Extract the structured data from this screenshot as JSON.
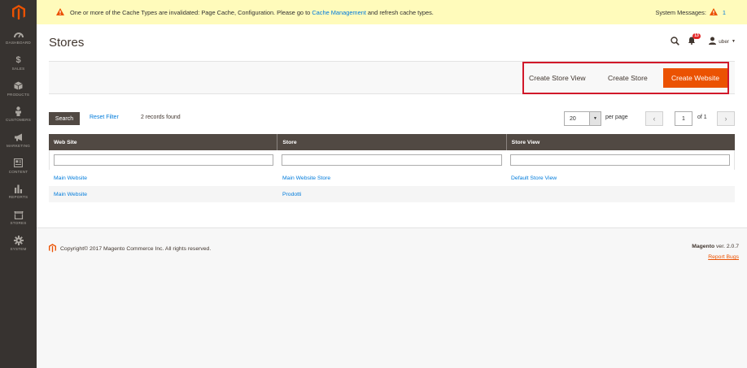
{
  "sidebar": {
    "items": [
      {
        "label": "DASHBOARD",
        "icon": "dashboard-icon"
      },
      {
        "label": "SALES",
        "icon": "dollar-icon"
      },
      {
        "label": "PRODUCTS",
        "icon": "cube-icon"
      },
      {
        "label": "CUSTOMERS",
        "icon": "person-icon"
      },
      {
        "label": "MARKETING",
        "icon": "megaphone-icon"
      },
      {
        "label": "CONTENT",
        "icon": "content-icon"
      },
      {
        "label": "REPORTS",
        "icon": "bar-chart-icon"
      },
      {
        "label": "STORES",
        "icon": "store-icon"
      },
      {
        "label": "SYSTEM",
        "icon": "gear-icon"
      }
    ]
  },
  "notice": {
    "text_before": "One or more of the Cache Types are invalidated: Page Cache, Configuration. Please go to ",
    "link": "Cache Management",
    "text_after": " and refresh cache types.",
    "system_label": "System Messages:",
    "system_count": "1"
  },
  "header": {
    "title": "Stores",
    "notifications_count": "13",
    "user": "uber"
  },
  "actions": {
    "create_store_view": "Create Store View",
    "create_store": "Create Store",
    "create_website": "Create Website"
  },
  "toolbar": {
    "search": "Search",
    "reset_filter": "Reset Filter",
    "records": "2 records found",
    "per_page_value": "20",
    "per_page_label": "per page",
    "page": "1",
    "of_pages": "of 1"
  },
  "grid": {
    "columns": [
      "Web Site",
      "Store",
      "Store View"
    ],
    "rows": [
      [
        "Main Website",
        "Main Website Store",
        "Default Store View"
      ],
      [
        "Main Website",
        "Prodotti",
        ""
      ]
    ]
  },
  "footer": {
    "copyright": "Copyright© 2017 Magento Commerce Inc. All rights reserved.",
    "brand": "Magento",
    "version": " ver. 2.0.7",
    "report_bugs": "Report Bugs"
  },
  "colors": {
    "accent": "#eb5202",
    "sidebar": "#373330",
    "link": "#007bdb",
    "highlight": "#d1182a"
  }
}
